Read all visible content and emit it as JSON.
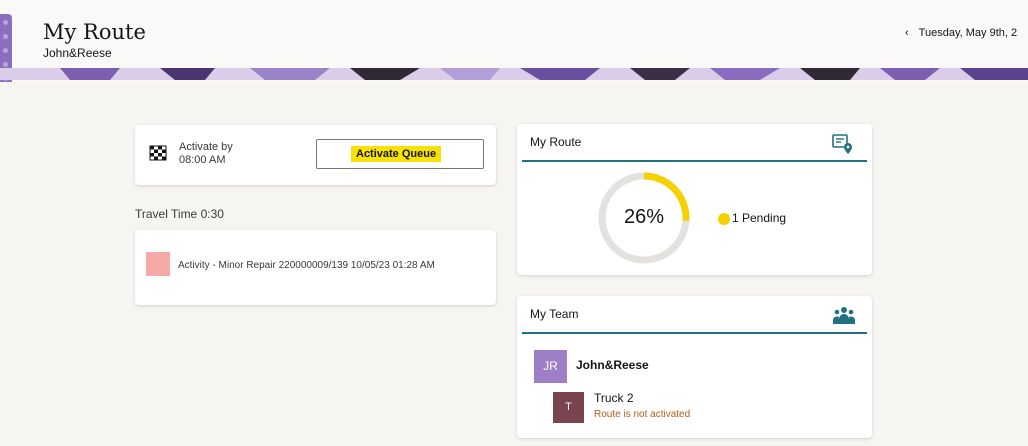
{
  "header": {
    "title": "My Route",
    "subtitle": "John&Reese",
    "date": "Tuesday, May 9th, 2"
  },
  "activate": {
    "label": "Activate by",
    "time": "08:00 AM",
    "button": "Activate Queue"
  },
  "travel": {
    "label": "Travel Time 0:30"
  },
  "activity": {
    "text": "Activity - Minor Repair 220000009/139 10/05/23 01:28 AM",
    "color": "#f7a9a7"
  },
  "route": {
    "title": "My Route",
    "percent_label": "26%",
    "percent": 0.26,
    "pending": "1 Pending",
    "accent": "#f7d000"
  },
  "team": {
    "title": "My Team",
    "name": "John&Reese",
    "initials": "JR",
    "truck": {
      "initial": "T",
      "name": "Truck 2",
      "status": "Route is not activated"
    }
  },
  "icons": {
    "back": "chevron-left-icon",
    "flag": "checkered-flag-icon",
    "route": "route-map-icon",
    "team": "team-group-icon"
  },
  "colors": {
    "teal_rule": "#227180",
    "purple": "#9c7fc4",
    "truck_avatar": "#7a4350",
    "status_text": "#b45b1d"
  }
}
